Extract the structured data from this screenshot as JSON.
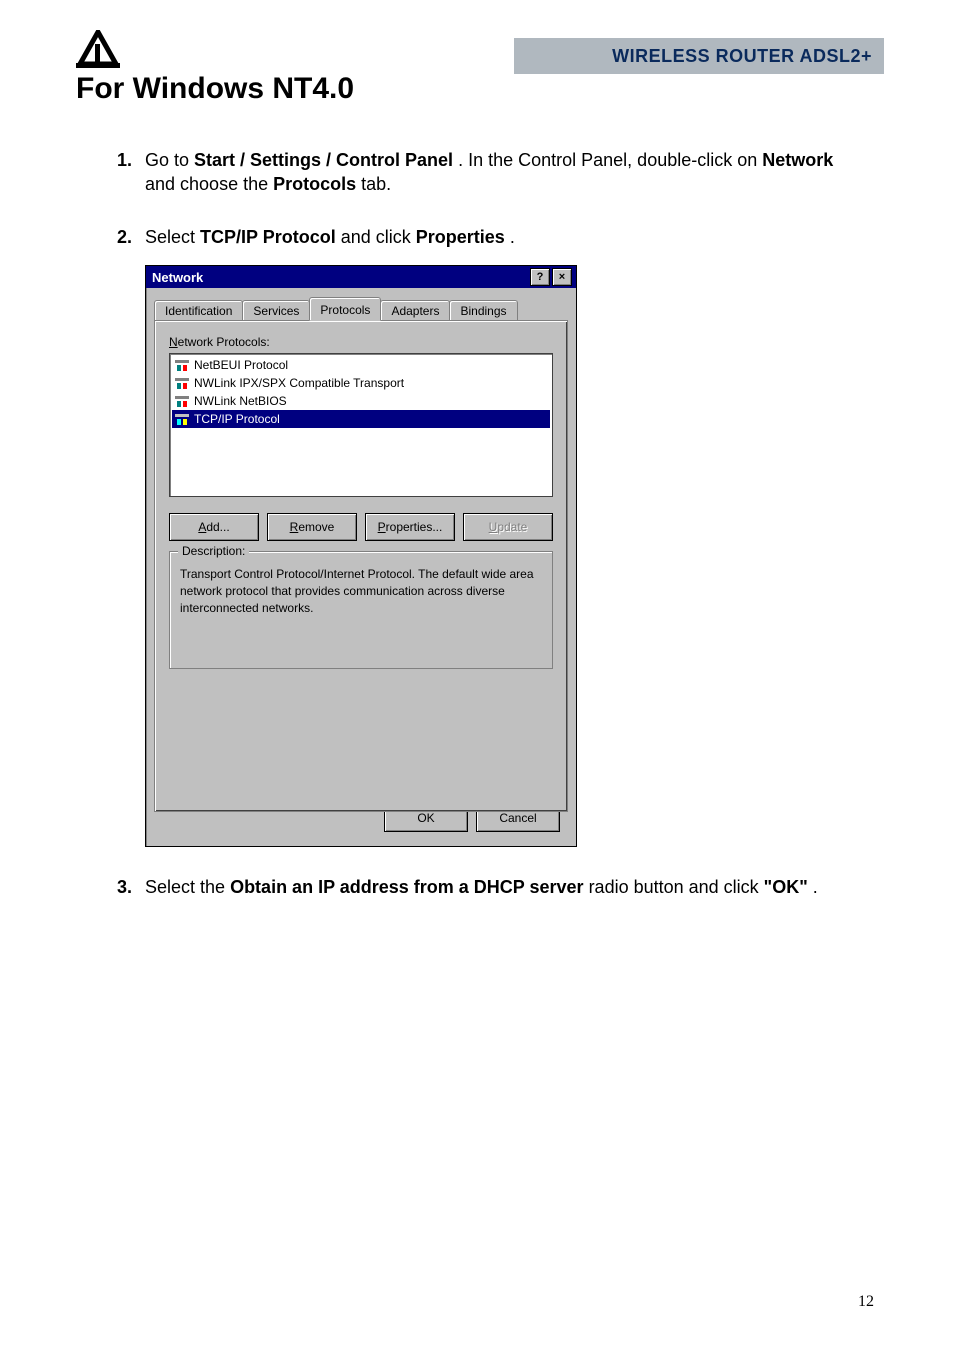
{
  "header": {
    "product": "WIRELESS ROUTER ADSL2+"
  },
  "title": "For Windows NT4.0",
  "steps": {
    "s1": {
      "num": "1.",
      "pre": "Go to ",
      "bold1": "Start / Settings / Control Panel",
      "mid1": ". In the Control Panel, double-click on ",
      "bold2": "Network",
      "mid2": " and choose the ",
      "bold3": "Protocols",
      "post": " tab."
    },
    "s2": {
      "num": "2.",
      "pre": "Select ",
      "bold1": "TCP/IP Protocol",
      "mid1": " and click ",
      "bold2": "Properties",
      "post": "."
    },
    "s3": {
      "num": "3.",
      "pre": "Select the ",
      "bold1": "Obtain an IP address from a DHCP server",
      "mid1": " radio button and click ",
      "bold2": "\"OK\"",
      "post": "."
    }
  },
  "dialog": {
    "title": "Network",
    "help": "?",
    "close": "×",
    "tabs": [
      "Identification",
      "Services",
      "Protocols",
      "Adapters",
      "Bindings"
    ],
    "active_tab": 2,
    "list_label_pre": "N",
    "list_label_post": "etwork Protocols:",
    "items": [
      "NetBEUI Protocol",
      "NWLink IPX/SPX Compatible Transport",
      "NWLink NetBIOS",
      "TCP/IP Protocol"
    ],
    "selected_index": 3,
    "buttons": {
      "add_u": "A",
      "add_r": "dd...",
      "remove_u": "R",
      "remove_r": "emove",
      "props_u": "P",
      "props_r": "roperties...",
      "update_u": "U",
      "update_r": "pdate"
    },
    "group_label": "Description:",
    "description": "Transport Control Protocol/Internet Protocol. The default wide area network protocol that provides communication across diverse interconnected networks.",
    "ok": "OK",
    "cancel": "Cancel"
  },
  "pagenum": "12"
}
